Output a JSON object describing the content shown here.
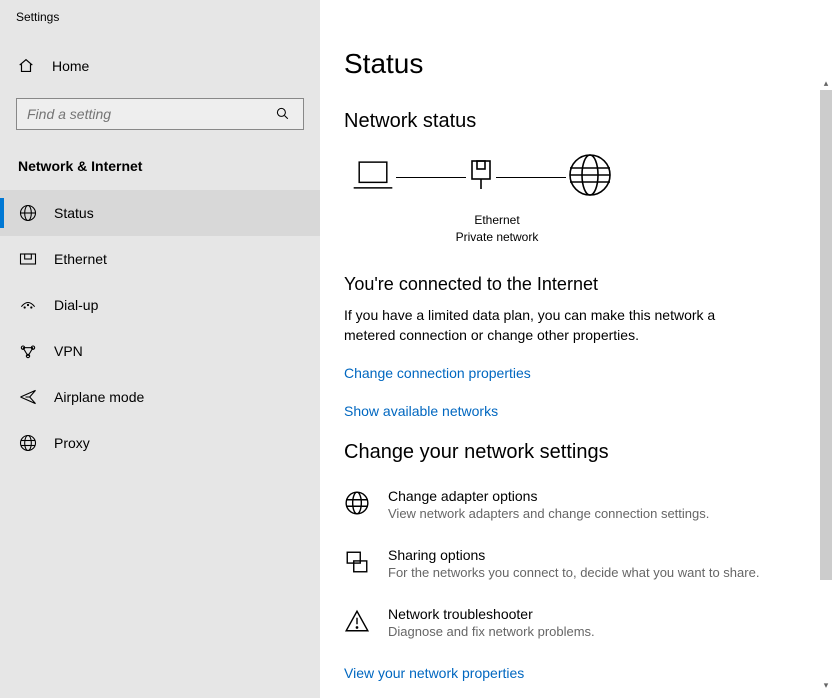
{
  "window": {
    "title": "Settings"
  },
  "titlebar": {
    "min": "−",
    "max": "☐",
    "close": "✕"
  },
  "sidebar": {
    "home": "Home",
    "search_placeholder": "Find a setting",
    "category": "Network & Internet",
    "items": [
      {
        "label": "Status"
      },
      {
        "label": "Ethernet"
      },
      {
        "label": "Dial-up"
      },
      {
        "label": "VPN"
      },
      {
        "label": "Airplane mode"
      },
      {
        "label": "Proxy"
      }
    ]
  },
  "main": {
    "title": "Status",
    "network_status_heading": "Network status",
    "diagram": {
      "name": "Ethernet",
      "type": "Private network"
    },
    "connected_heading": "You're connected to the Internet",
    "connected_body": "If you have a limited data plan, you can make this network a metered connection or change other properties.",
    "link_change_conn": "Change connection properties",
    "link_show_networks": "Show available networks",
    "change_settings_heading": "Change your network settings",
    "items": [
      {
        "title": "Change adapter options",
        "desc": "View network adapters and change connection settings."
      },
      {
        "title": "Sharing options",
        "desc": "For the networks you connect to, decide what you want to share."
      },
      {
        "title": "Network troubleshooter",
        "desc": "Diagnose and fix network problems."
      }
    ],
    "link_view_props": "View your network properties"
  }
}
